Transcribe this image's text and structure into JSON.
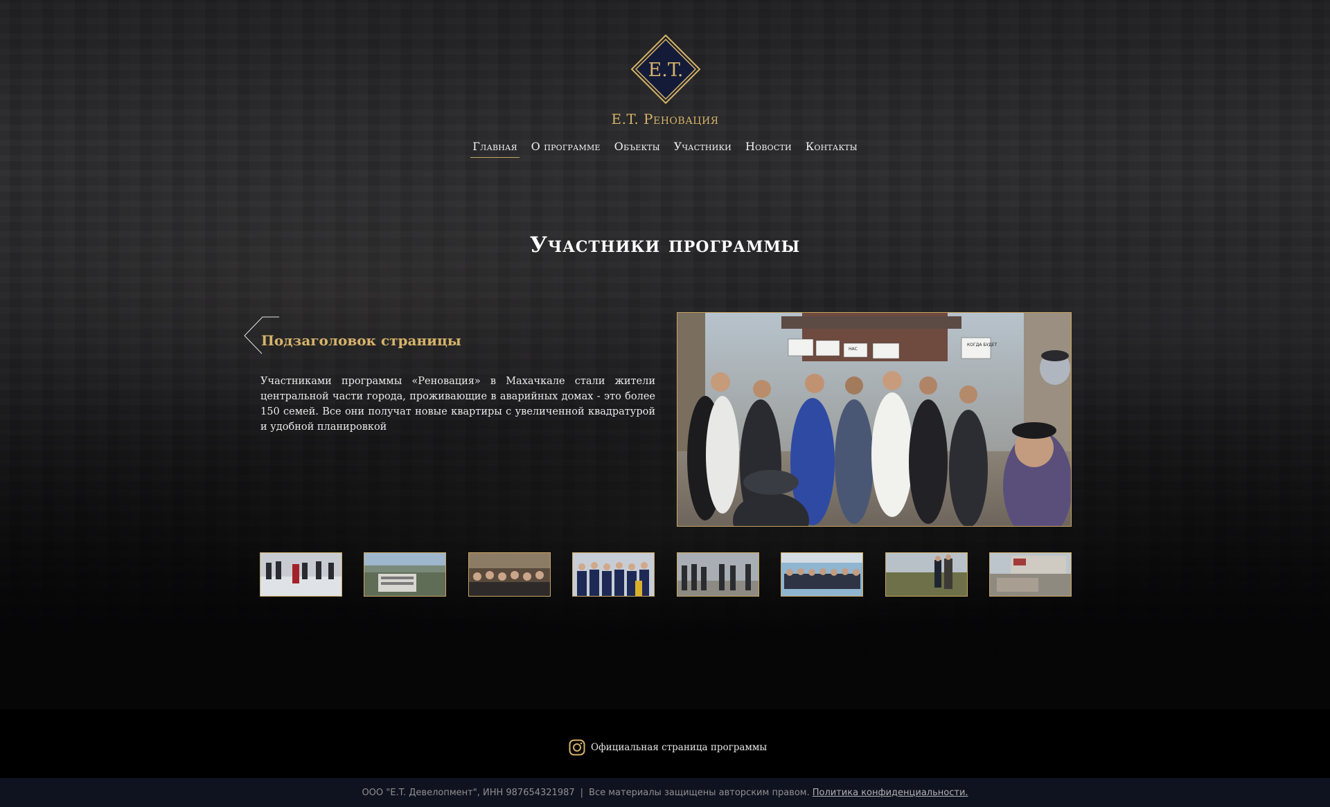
{
  "header": {
    "logo_text": "E.T.",
    "brand_name": "E.T. Реновация",
    "nav": [
      {
        "label": "Главная",
        "active": true
      },
      {
        "label": "О программе",
        "active": false
      },
      {
        "label": "Объекты",
        "active": false
      },
      {
        "label": "Участники",
        "active": false
      },
      {
        "label": "Новости",
        "active": false
      },
      {
        "label": "Контакты",
        "active": false
      }
    ]
  },
  "main": {
    "title": "Участники программы",
    "subtitle": "Подзаголовок страницы",
    "lead": "Участниками программы «Реновация» в Махачкале стали жители центральной части города, проживающие в аварийных домах - это более 150 семей. Все они получат новые квартиры с увеличенной квадратурой и удобной планировкой",
    "photo_signs": [
      "КОГДА БУДЕТ",
      "НАС"
    ],
    "thumbnail_count": 8
  },
  "footer": {
    "instagram_label": "Официальная страница программы",
    "company": "ООО \"E.T. Девелопмент\", ИНН 987654321987",
    "separator": "|",
    "rights": "Все материалы защищены авторским правом.",
    "policy_link": "Политика конфиденциальности."
  },
  "colors": {
    "accent_gold": "#d6b36a",
    "border_gold": "#c9a660",
    "logo_navy": "#131b38",
    "footer_bottom": "#0f1320"
  }
}
